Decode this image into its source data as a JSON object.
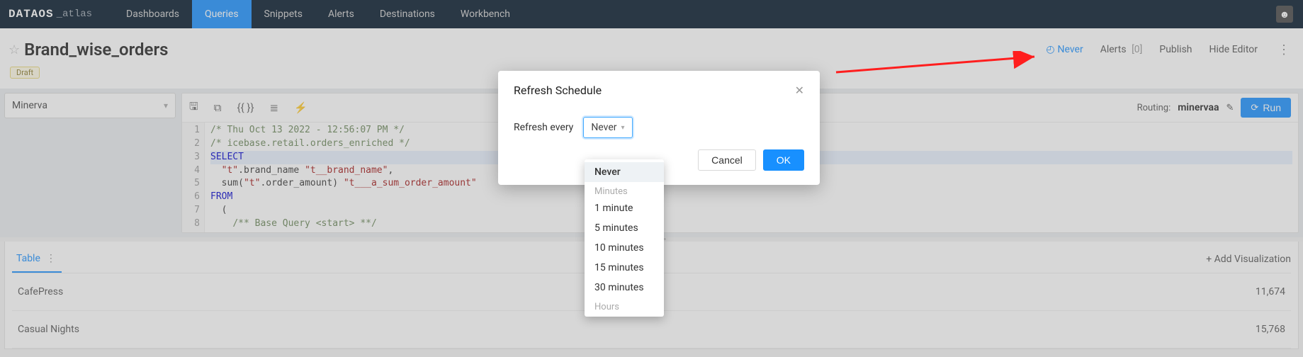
{
  "brand": {
    "main": "DATAOS",
    "sub": "_atlas"
  },
  "nav": [
    "Dashboards",
    "Queries",
    "Snippets",
    "Alerts",
    "Destinations",
    "Workbench"
  ],
  "nav_active_index": 1,
  "page": {
    "title": "Brand_wise_orders",
    "draft_label": "Draft"
  },
  "header": {
    "never": "Never",
    "alerts_label": "Alerts",
    "alerts_count": "[0]",
    "publish": "Publish",
    "hide_editor": "Hide Editor"
  },
  "datasource": {
    "selected": "Minerva"
  },
  "routing": {
    "label": "Routing:",
    "value": "minervaa"
  },
  "run_label": "Run",
  "code_lines": [
    {
      "n": 1,
      "cls": "",
      "html": "<span class='cm'>/* Thu Oct 13 2022 - 12:56:07 PM */</span>"
    },
    {
      "n": 2,
      "cls": "",
      "html": "<span class='cm'>/* icebase.retail.orders_enriched */</span>"
    },
    {
      "n": 3,
      "cls": "hl",
      "html": "<span class='kw'>SELECT</span>"
    },
    {
      "n": 4,
      "cls": "",
      "html": "  <span class='str'>\"t\"</span>.brand_name <span class='str'>\"t__brand_name\"</span>,"
    },
    {
      "n": 5,
      "cls": "",
      "html": "  <span class='fn'>sum</span>(<span class='str'>\"t\"</span>.order_amount) <span class='str'>\"t___a_sum_order_amount\"</span>"
    },
    {
      "n": 6,
      "cls": "",
      "html": "<span class='kw'>FROM</span>"
    },
    {
      "n": 7,
      "cls": "",
      "html": "  ("
    },
    {
      "n": 8,
      "cls": "",
      "html": "    <span class='cm'>/** Base Query &lt;start&gt; **/</span>"
    }
  ],
  "tabs": {
    "active": "Table",
    "add_viz": "+ Add Visualization"
  },
  "rows": [
    {
      "label": "CafePress",
      "value": "11,674"
    },
    {
      "label": "Casual Nights",
      "value": "15,768"
    }
  ],
  "modal": {
    "title": "Refresh Schedule",
    "refresh_label": "Refresh every",
    "select_value": "Never",
    "cancel": "Cancel",
    "ok": "OK"
  },
  "dropdown": {
    "items": [
      {
        "kind": "item",
        "label": "Never",
        "selected": true
      },
      {
        "kind": "header",
        "label": "Minutes"
      },
      {
        "kind": "item",
        "label": "1 minute"
      },
      {
        "kind": "item",
        "label": "5 minutes"
      },
      {
        "kind": "item",
        "label": "10 minutes"
      },
      {
        "kind": "item",
        "label": "15 minutes"
      },
      {
        "kind": "item",
        "label": "30 minutes"
      },
      {
        "kind": "header",
        "label": "Hours"
      }
    ]
  }
}
